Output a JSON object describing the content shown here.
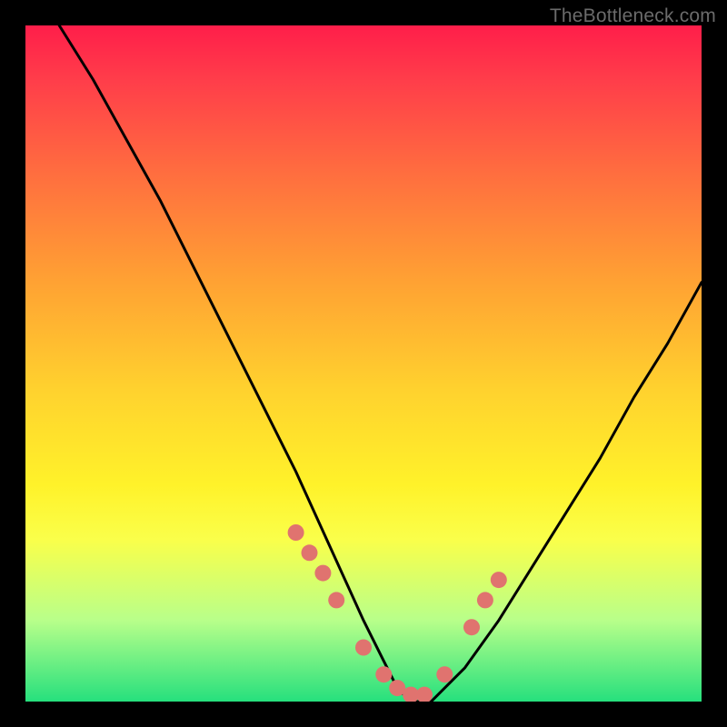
{
  "watermark": "TheBottleneck.com",
  "chart_data": {
    "type": "line",
    "title": "",
    "xlabel": "",
    "ylabel": "",
    "xlim": [
      0,
      100
    ],
    "ylim": [
      0,
      100
    ],
    "series": [
      {
        "name": "bottleneck-curve",
        "x": [
          5,
          10,
          15,
          20,
          25,
          30,
          35,
          40,
          45,
          50,
          53,
          55,
          57,
          60,
          65,
          70,
          75,
          80,
          85,
          90,
          95,
          100
        ],
        "y": [
          100,
          92,
          83,
          74,
          64,
          54,
          44,
          34,
          23,
          12,
          6,
          2,
          0,
          0,
          5,
          12,
          20,
          28,
          36,
          45,
          53,
          62
        ]
      }
    ],
    "markers": {
      "name": "highlight-dots",
      "x": [
        40,
        42,
        44,
        46,
        50,
        53,
        55,
        57,
        59,
        62,
        66,
        68,
        70
      ],
      "y": [
        25,
        22,
        19,
        15,
        8,
        4,
        2,
        1,
        1,
        4,
        11,
        15,
        18
      ]
    },
    "background_gradient": {
      "top": "#ff1e4a",
      "mid": "#ffd22e",
      "bottom": "#26e07d"
    },
    "marker_color": "#e0736f",
    "curve_color": "#000000"
  }
}
